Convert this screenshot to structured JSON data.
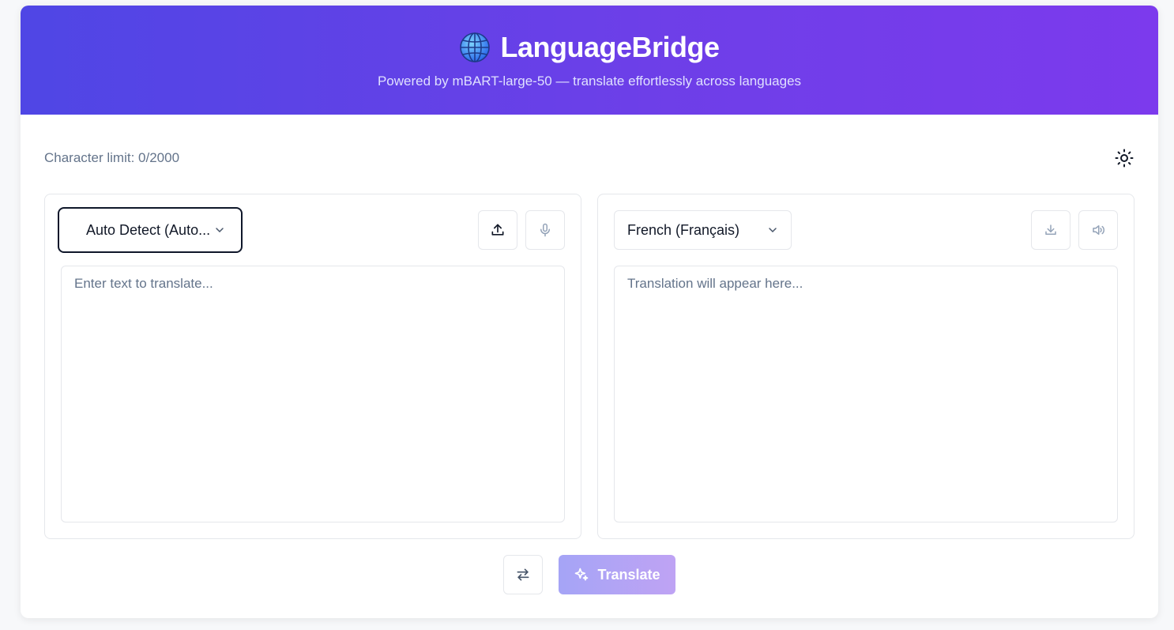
{
  "header": {
    "title": "LanguageBridge",
    "globe_icon": "globe-icon",
    "subtitle": "Powered by mBART-large-50 — translate effortlessly across languages",
    "gradient_start": "#4f46e5",
    "gradient_end": "#7c3aed"
  },
  "toolbar": {
    "char_limit": "Character limit: 0/2000",
    "theme_icon": "sun-icon"
  },
  "source": {
    "language": "Auto Detect (Auto...",
    "placeholder": "Enter text to translate...",
    "upload_icon": "upload-icon",
    "mic_icon": "microphone-icon"
  },
  "target": {
    "language": "French (Français)",
    "placeholder": "Translation will appear here...",
    "download_icon": "download-icon",
    "speaker_icon": "speaker-icon"
  },
  "actions": {
    "swap_icon": "swap-icon",
    "translate_label": "Translate",
    "translate_icon": "sparkles-icon"
  }
}
